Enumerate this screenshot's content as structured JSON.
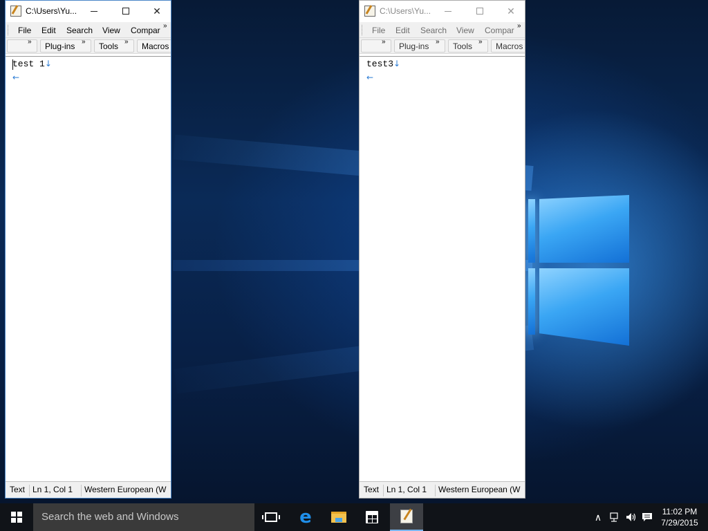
{
  "windows": [
    {
      "title": "C:\\Users\\Yu...",
      "menu": [
        "File",
        "Edit",
        "Search",
        "View",
        "Compar"
      ],
      "toolbar": [
        "Plug-ins",
        "Tools",
        "Macros"
      ],
      "content": {
        "line1": "test 1",
        "eol_mark": "↓",
        "line2_mark": "←"
      },
      "status": {
        "type": "Text",
        "position": "Ln 1, Col 1",
        "encoding": "Western European (W"
      },
      "state": "active"
    },
    {
      "title": "C:\\Users\\Yu...",
      "menu": [
        "File",
        "Edit",
        "Search",
        "View",
        "Compar"
      ],
      "toolbar": [
        "Plug-ins",
        "Tools",
        "Macros"
      ],
      "content": {
        "line1": "test3",
        "eol_mark": "↓",
        "line2_mark": "←"
      },
      "status": {
        "type": "Text",
        "position": "Ln 1, Col 1",
        "encoding": "Western European (W"
      },
      "state": "inactive"
    }
  ],
  "window_controls": {
    "min_icon": "minimize-icon",
    "max_icon": "maximize-icon",
    "close_glyph": "✕",
    "chevron": "»"
  },
  "taskbar": {
    "search_placeholder": "Search the web and Windows",
    "clock_time": "11:02 PM",
    "clock_date": "7/29/2015",
    "tray_up": "∧",
    "colors": {
      "taskbar_bg": "#101318",
      "accent": "#1f8fea"
    }
  }
}
